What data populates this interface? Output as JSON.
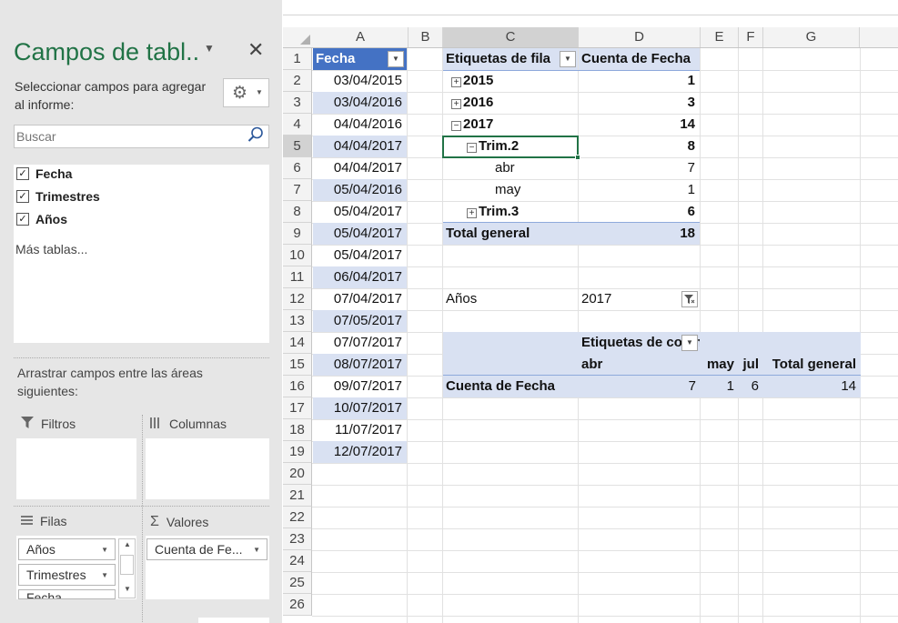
{
  "pane": {
    "title": "Campos de tabl..",
    "description": "Seleccionar campos para agregar al informe:",
    "search_placeholder": "Buscar",
    "fields": [
      {
        "label": "Fecha",
        "checked": true
      },
      {
        "label": "Trimestres",
        "checked": true
      },
      {
        "label": "Años",
        "checked": true
      }
    ],
    "more_tables": "Más tablas...",
    "drag_desc": "Arrastrar campos entre las áreas siguientes:",
    "areas": {
      "filters": "Filtros",
      "columns": "Columnas",
      "rows": "Filas",
      "values": "Valores"
    },
    "rows_chips": [
      "Años",
      "Trimestres",
      "Fecha"
    ],
    "values_chips": [
      "Cuenta de Fe..."
    ]
  },
  "grid": {
    "columns": [
      "A",
      "B",
      "C",
      "D",
      "E",
      "F",
      "G"
    ],
    "selected_column": "C",
    "selected_row": "5",
    "rows": [
      "1",
      "2",
      "3",
      "4",
      "5",
      "6",
      "7",
      "8",
      "9",
      "10",
      "11",
      "12",
      "13",
      "14",
      "15",
      "16",
      "17",
      "18",
      "19",
      "20",
      "21",
      "22",
      "23",
      "24",
      "25",
      "26"
    ],
    "colA_header": "Fecha",
    "colA_values": [
      "03/04/2015",
      "03/04/2016",
      "04/04/2016",
      "04/04/2017",
      "04/04/2017",
      "05/04/2016",
      "05/04/2017",
      "05/04/2017",
      "05/04/2017",
      "06/04/2017",
      "07/04/2017",
      "07/05/2017",
      "07/07/2017",
      "08/07/2017",
      "09/07/2017",
      "10/07/2017",
      "11/07/2017",
      "12/07/2017"
    ]
  },
  "pivot1": {
    "header_label": "Etiquetas de fila",
    "header_value": "Cuenta de Fecha",
    "rows": [
      {
        "toggle": "+",
        "label": "2015",
        "value": "1"
      },
      {
        "toggle": "+",
        "label": "2016",
        "value": "3"
      },
      {
        "toggle": "-",
        "label": "2017",
        "value": "14"
      },
      {
        "toggle": "-",
        "label": "Trim.2",
        "value": "8"
      },
      {
        "toggle": "",
        "label": "abr",
        "value": "7"
      },
      {
        "toggle": "",
        "label": "may",
        "value": "1"
      },
      {
        "toggle": "+",
        "label": "Trim.3",
        "value": "6"
      }
    ],
    "total_label": "Total general",
    "total_value": "18"
  },
  "pivot2": {
    "filter_label": "Años",
    "filter_value": "2017",
    "col_header": "Etiquetas de columna",
    "col_labels": [
      "abr",
      "may",
      "jul",
      "Total general"
    ],
    "row_label": "Cuenta de Fecha",
    "values": [
      "7",
      "1",
      "6",
      "14"
    ]
  },
  "icons": {
    "pm_plus": "⊞",
    "pm_minus": "⊟"
  }
}
